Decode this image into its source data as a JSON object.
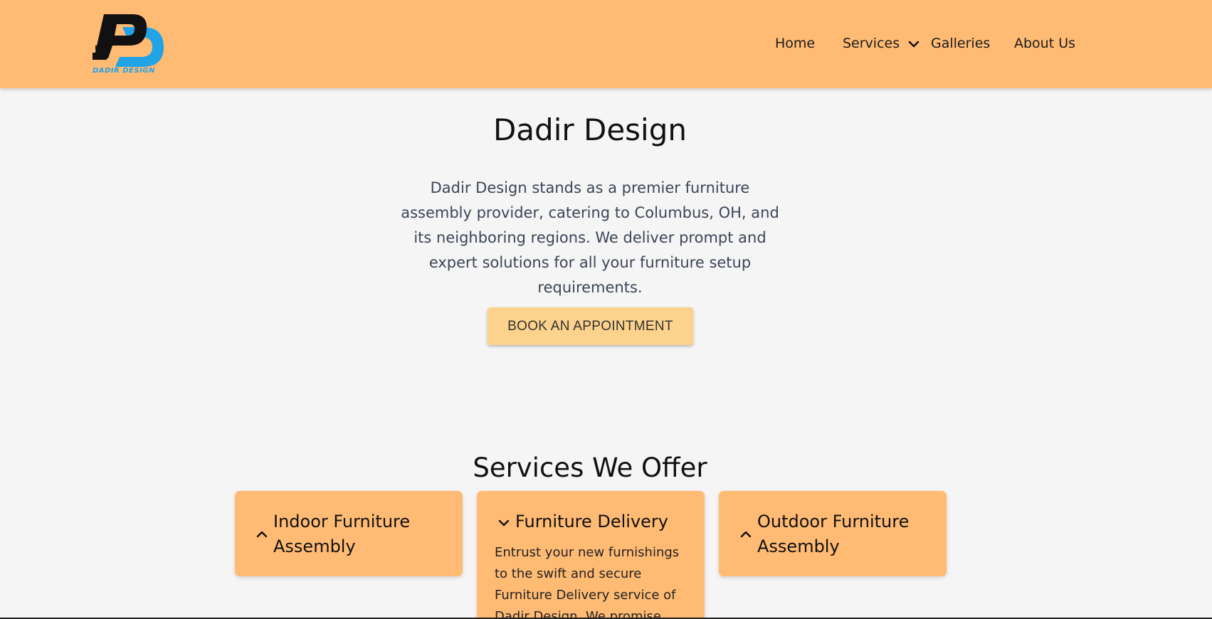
{
  "brand": {
    "name": "DADIR DESIGN",
    "colors": {
      "header": "#ffbb74",
      "logo_blue": "#21a3e6",
      "button": "#fdd28c"
    }
  },
  "nav": {
    "home": "Home",
    "services": "Services",
    "galleries": "Galleries",
    "about": "About Us"
  },
  "hero": {
    "title": "Dadir Design",
    "description": "Dadir Design stands as a premier furniture assembly provider, catering to Columbus, OH, and its neighboring regions. We deliver prompt and expert solutions for all your furniture setup requirements.",
    "cta": "BOOK AN APPOINTMENT"
  },
  "services": {
    "title": "Services We Offer",
    "cards": [
      {
        "title": "Indoor Furniture Assembly",
        "icon": "chevron-up-icon",
        "expanded": false
      },
      {
        "title": "Furniture Delivery",
        "icon": "chevron-down-icon",
        "expanded": true,
        "body": "Entrust your new furnishings to the swift and secure Furniture Delivery service of Dadir Design. We promise"
      },
      {
        "title": "Outdoor Furniture Assembly",
        "icon": "chevron-up-icon",
        "expanded": false
      }
    ]
  }
}
